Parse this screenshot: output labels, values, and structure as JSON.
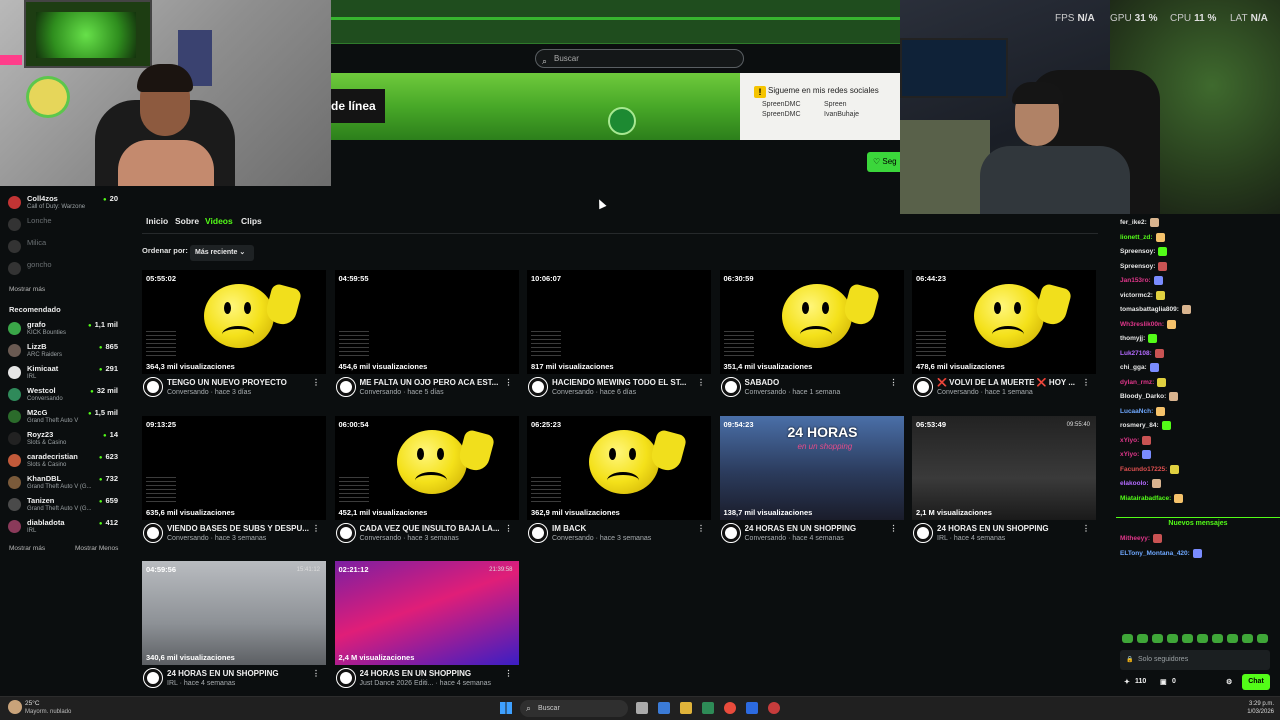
{
  "search": {
    "placeholder": "Buscar"
  },
  "banner": {
    "label": "de línea",
    "social_title": "Sigueme en mis redes sociales",
    "handles": [
      "SpreenDMC",
      "Spreen",
      "SpreenDMC",
      "IvanBuhaje"
    ]
  },
  "follow_label": "♡ Seg",
  "stats": {
    "fps_label": "FPS",
    "fps": "N/A",
    "gpu_label": "GPU",
    "gpu": "31 %",
    "cpu_label": "CPU",
    "cpu": "11 %",
    "lat_label": "LAT",
    "lat": "N/A"
  },
  "sidebar": {
    "following": [
      {
        "name": "Coll4zos",
        "game": "Call of Duty: Warzone",
        "count": "20",
        "online": true,
        "color": "#c23434"
      },
      {
        "name": "Lonche",
        "game": "",
        "count": "",
        "online": false,
        "color": "#333333"
      },
      {
        "name": "Milica",
        "game": "",
        "count": "",
        "online": false,
        "color": "#333333"
      },
      {
        "name": "goncho",
        "game": "",
        "count": "",
        "online": false,
        "color": "#333333"
      }
    ],
    "show_more": "Mostrar más",
    "recommended_title": "Recomendado",
    "recommended": [
      {
        "name": "grafo",
        "game": "KICK Bounties",
        "count": "1,1 mil",
        "color": "#3aa648"
      },
      {
        "name": "LizzB",
        "game": "ARC Raiders",
        "count": "865",
        "color": "#6a5a52"
      },
      {
        "name": "Kimicaat",
        "game": "IRL",
        "count": "291",
        "color": "#e6e6e6"
      },
      {
        "name": "Westcol",
        "game": "Conversando",
        "count": "32 mil",
        "color": "#2f8a5a"
      },
      {
        "name": "M2cG",
        "game": "Grand Theft Auto V",
        "count": "1,5 mil",
        "color": "#2b6b2b"
      },
      {
        "name": "Royz23",
        "game": "Slots & Casino",
        "count": "14",
        "color": "#222222"
      },
      {
        "name": "caradecristian",
        "game": "Slots & Casino",
        "count": "623",
        "color": "#c25a3a"
      },
      {
        "name": "KhanDBL",
        "game": "Grand Theft Auto V (G...",
        "count": "732",
        "color": "#7a5a3a"
      },
      {
        "name": "Tanizen",
        "game": "Grand Theft Auto V (G...",
        "count": "659",
        "color": "#4a4a4a"
      },
      {
        "name": "diabladota",
        "game": "IRL",
        "count": "412",
        "color": "#8a3a5a"
      }
    ],
    "show_more2": "Mostrar más",
    "show_less": "Mostrar Menos"
  },
  "tabs": {
    "inicio": "Inicio",
    "sobre": "Sobre",
    "videos": "Videos",
    "clips": "Clips"
  },
  "sort": {
    "label": "Ordenar por:",
    "value": "Más reciente"
  },
  "videos": [
    {
      "duration": "05:55:02",
      "views": "364,3 mil visualizaciones",
      "title": "TENGO UN NUEVO PROYECTO",
      "category": "Conversando",
      "age": "hace 3 días",
      "scene": "smiley"
    },
    {
      "duration": "04:59:55",
      "views": "454,6 mil visualizaciones",
      "title": "ME FALTA UN OJO PERO ACA EST...",
      "category": "Conversando",
      "age": "hace 5 días",
      "scene": "black"
    },
    {
      "duration": "10:06:07",
      "views": "817 mil visualizaciones",
      "title": "HACIENDO MEWING TODO EL ST...",
      "category": "Conversando",
      "age": "hace 6 días",
      "scene": "black"
    },
    {
      "duration": "06:30:59",
      "views": "351,4 mil visualizaciones",
      "title": "SABADO",
      "category": "Conversando",
      "age": "hace 1 semana",
      "scene": "smiley"
    },
    {
      "duration": "06:44:23",
      "views": "478,6 mil visualizaciones",
      "title": "❌ VOLVI DE LA MUERTE ❌ HOY ...",
      "category": "Conversando",
      "age": "hace 1 semana",
      "scene": "smiley"
    },
    {
      "duration": "09:13:25",
      "views": "635,6 mil visualizaciones",
      "title": "VIENDO BASES DE SUBS Y DESPU...",
      "category": "Conversando",
      "age": "hace 3 semanas",
      "scene": "black"
    },
    {
      "duration": "06:00:54",
      "views": "452,1 mil visualizaciones",
      "title": "CADA VEZ QUE INSULTO BAJA LA...",
      "category": "Conversando",
      "age": "hace 3 semanas",
      "scene": "smiley"
    },
    {
      "duration": "06:25:23",
      "views": "362,9 mil visualizaciones",
      "title": "IM BACK",
      "category": "Conversando",
      "age": "hace 3 semanas",
      "scene": "smiley"
    },
    {
      "duration": "09:54:23",
      "views": "138,7 mil visualizaciones",
      "title": "24 HORAS EN UN SHOPPING",
      "category": "Conversando",
      "age": "hace 4 semanas",
      "scene": "mall",
      "overlay": "24 HORAS",
      "overlay_sub": "en un shopping"
    },
    {
      "duration": "06:53:49",
      "views": "2,1 M visualizaciones",
      "title": "24 HORAS EN UN SHOPPING",
      "category": "IRL",
      "age": "hace 4 semanas",
      "scene": "room",
      "timecode": "09:55:40"
    },
    {
      "duration": "04:59:56",
      "views": "340,6 mil visualizaciones",
      "title": "24 HORAS EN UN SHOPPING",
      "category": "IRL",
      "age": "hace 4 semanas",
      "scene": "kitchen",
      "timecode": "15:41:12"
    },
    {
      "duration": "02:21:12",
      "views": "2,4 M visualizaciones",
      "title": "24 HORAS EN UN SHOPPING",
      "category": "Just Dance 2026 Editi...",
      "age": "hace 4 semanas",
      "scene": "dance",
      "timecode": "21:39:58"
    }
  ],
  "chat": {
    "messages": [
      {
        "user": "fer_ike2:",
        "color": "#e8e8e8"
      },
      {
        "user": "lionett_zd:",
        "color": "#53fc18"
      },
      {
        "user": "Spreensoy:",
        "color": "#e8e8e8"
      },
      {
        "user": "Spreensoy:",
        "color": "#e8e8e8"
      },
      {
        "user": "Jan153ro:",
        "color": "#e0368a"
      },
      {
        "user": "victormc2:",
        "color": "#e8e8e8"
      },
      {
        "user": "tomasbattaglia809:",
        "color": "#e8e8e8"
      },
      {
        "user": "Wh3reslik00n:",
        "color": "#e0368a"
      },
      {
        "user": "thomyjj:",
        "color": "#e8e8e8"
      },
      {
        "user": "Luk27108:",
        "color": "#b46bff"
      },
      {
        "user": "chi_gga:",
        "color": "#e8e8e8"
      },
      {
        "user": "dylan_rmz:",
        "color": "#e0368a"
      },
      {
        "user": "Bloody_Darko:",
        "color": "#e8e8e8"
      },
      {
        "user": "LucaaNch:",
        "color": "#6fa8ff"
      },
      {
        "user": "rosmery_84:",
        "color": "#e8e8e8"
      },
      {
        "user": "xYiyo:",
        "color": "#e0368a"
      },
      {
        "user": "xYiyo:",
        "color": "#e0368a"
      },
      {
        "user": "Facundo17225:",
        "color": "#e05050"
      },
      {
        "user": "elakoolo:",
        "color": "#b46bff"
      },
      {
        "user": "Miatairabadface:",
        "color": "#53fc18"
      }
    ],
    "new_messages": "Nuevos mensajes",
    "after": [
      {
        "user": "Mitheeyy:",
        "color": "#e0368a"
      },
      {
        "user": "ELTony_Montana_420:",
        "color": "#6fa8ff"
      }
    ],
    "input_placeholder": "Solo seguidores",
    "points": "110",
    "gifts": "0",
    "send_label": "Chat"
  },
  "taskbar": {
    "temp": "25°C",
    "condition": "Mayorm. nublado",
    "search": "Buscar",
    "time": "3:29 p.m.",
    "date": "1/03/2026"
  }
}
